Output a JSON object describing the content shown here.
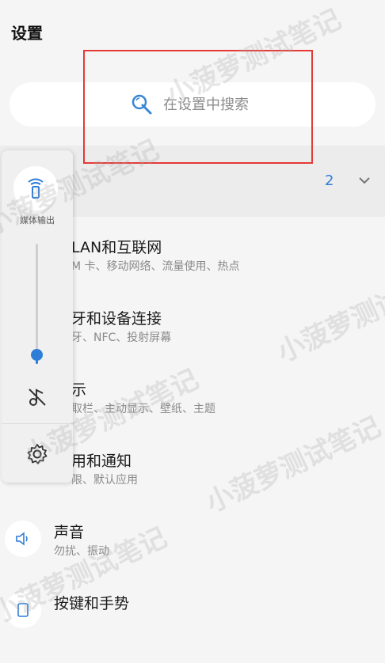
{
  "header": {
    "title": "设置"
  },
  "search": {
    "placeholder": "在设置中搜索"
  },
  "notification_band": {
    "count": "2"
  },
  "settings": [
    {
      "title": "LAN和互联网",
      "subtitle": "M 卡、移动网络、流量使用、热点"
    },
    {
      "title": "牙和设备连接",
      "subtitle": "牙、NFC、投射屏幕"
    },
    {
      "title": "示",
      "subtitle": "取栏、主动显示、壁纸、主题"
    },
    {
      "title": "用和通知",
      "subtitle": "限、默认应用"
    },
    {
      "title": "声音",
      "subtitle": "勿扰、振动",
      "icon": "speaker-icon"
    },
    {
      "title": "按键和手势",
      "subtitle": ""
    }
  ],
  "volume_panel": {
    "cast_label": "媒体输出",
    "level": 0.08
  },
  "watermark": "小菠萝测试笔记",
  "colors": {
    "accent": "#2e7dd7",
    "highlight_box": "#e53935"
  }
}
